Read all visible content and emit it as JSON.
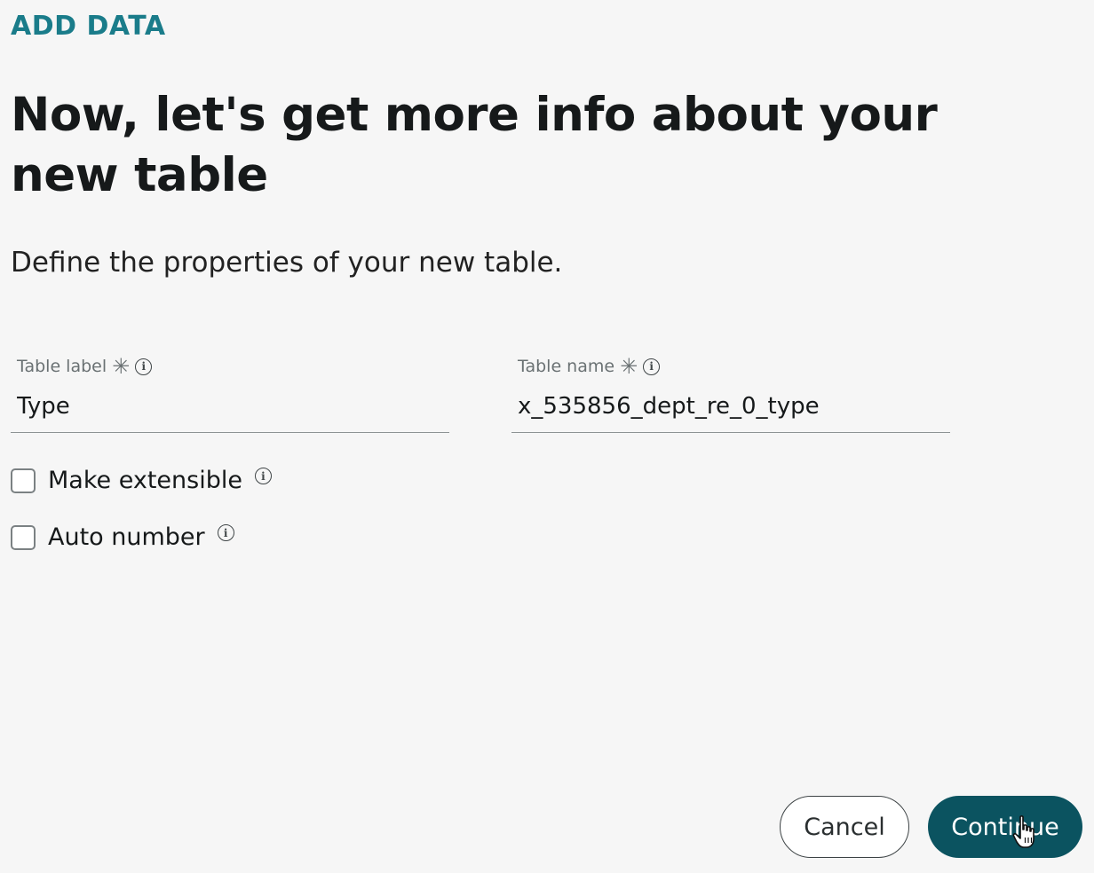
{
  "eyebrow": "ADD DATA",
  "heading": "Now, let's get more info about your new table",
  "subheading": "Define the properties of your new table.",
  "fields": {
    "table_label": {
      "label": "Table label",
      "value": "Type",
      "required_icon": "asterisk-icon",
      "info_icon": "info-icon"
    },
    "table_name": {
      "label": "Table name",
      "value": "x_535856_dept_re_0_type",
      "required_icon": "asterisk-icon",
      "info_icon": "info-icon"
    }
  },
  "checkboxes": {
    "make_extensible": {
      "label": "Make extensible",
      "checked": false
    },
    "auto_number": {
      "label": "Auto number",
      "checked": false
    }
  },
  "buttons": {
    "cancel": "Cancel",
    "continue": "Continue"
  },
  "colors": {
    "eyebrow": "#1a7c8a",
    "primary_button": "#0b5360",
    "background": "#f6f6f6"
  }
}
